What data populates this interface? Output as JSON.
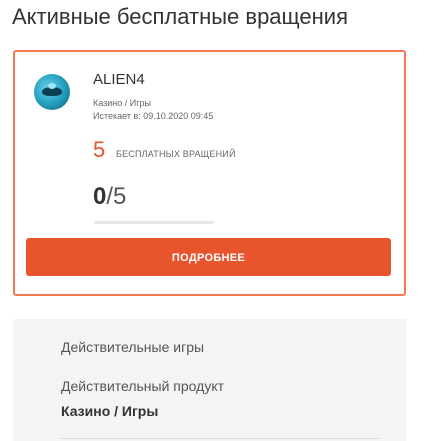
{
  "page_title": "Активные бесплатные вращения",
  "bonus_card": {
    "game_logo_icon": "alien-ufo-game-icon",
    "game_name": "ALIEN4",
    "category": "Казино / Игры",
    "expires_text": "Истекает в: 09.10.2020 09:45",
    "spins_count": "5",
    "spins_label": "БЕСПЛАТНЫХ ВРАЩЕНИЙ",
    "progress_used": "0",
    "progress_total": "/5",
    "progress_fraction": 0,
    "details_button": "ПОДРОБНЕЕ"
  },
  "info": {
    "valid_games_label": "Действительные игры",
    "valid_product_label": "Действительный продукт",
    "valid_product_value": "Казино / Игры"
  },
  "colors": {
    "accent": "#e8552c",
    "card_border": "#f47a55",
    "panel_background": "#f4f4f4"
  }
}
